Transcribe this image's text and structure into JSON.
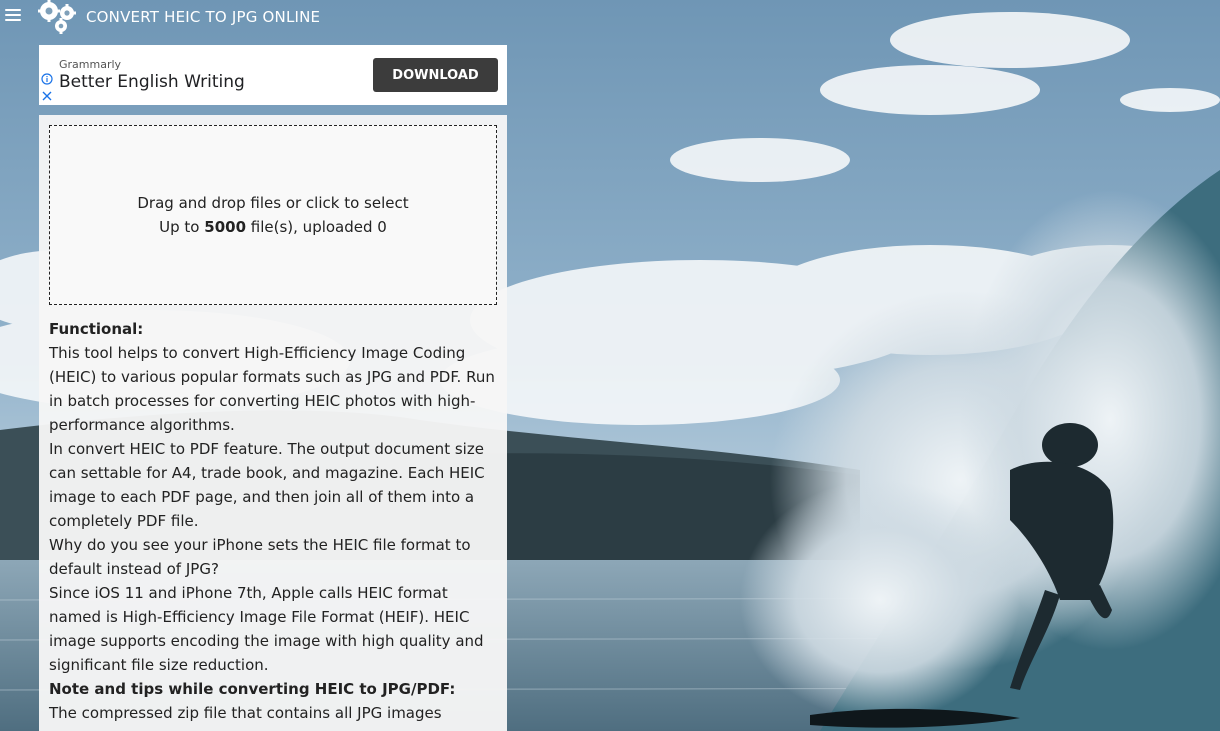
{
  "header": {
    "menu_icon": "hamburger-menu-icon",
    "logo_icon": "gears-icon",
    "title": "CONVERT HEIC TO JPG ONLINE"
  },
  "ad": {
    "brand": "Grammarly",
    "headline": "Better English Writing",
    "button_label": "DOWNLOAD",
    "info_icon": "info-icon",
    "close_icon": "close-icon",
    "button_color": "#3c3c3c",
    "info_color": "#1a73e8"
  },
  "dropzone": {
    "line1": "Drag and drop files or click to select",
    "prefix": "Up to ",
    "max_files": "5000",
    "suffix": " file(s), uploaded 0"
  },
  "content": {
    "heading1": "Functional:",
    "para1": "This tool helps to convert High-Efficiency Image Coding (HEIC) to various popular formats such as JPG and PDF. Run in batch processes for converting HEIC photos with high-performance algorithms.",
    "para2": "In convert HEIC to PDF feature. The output document size can settable for A4, trade book, and magazine. Each HEIC image to each PDF page, and then join all of them into a completely PDF file.",
    "para3": "Why do you see your iPhone sets the HEIC file format to default instead of JPG?",
    "para4": "Since iOS 11 and iPhone 7th, Apple calls HEIC format named is High-Efficiency Image File Format (HEIF). HEIC image supports encoding the image with high quality and significant file size reduction.",
    "heading2": "Note and tips while converting HEIC to JPG/PDF:",
    "para5": "The compressed zip file that contains all JPG images"
  },
  "colors": {
    "panel_bg": "#f6f6f6",
    "text": "#222222",
    "header_text": "#ffffff"
  }
}
